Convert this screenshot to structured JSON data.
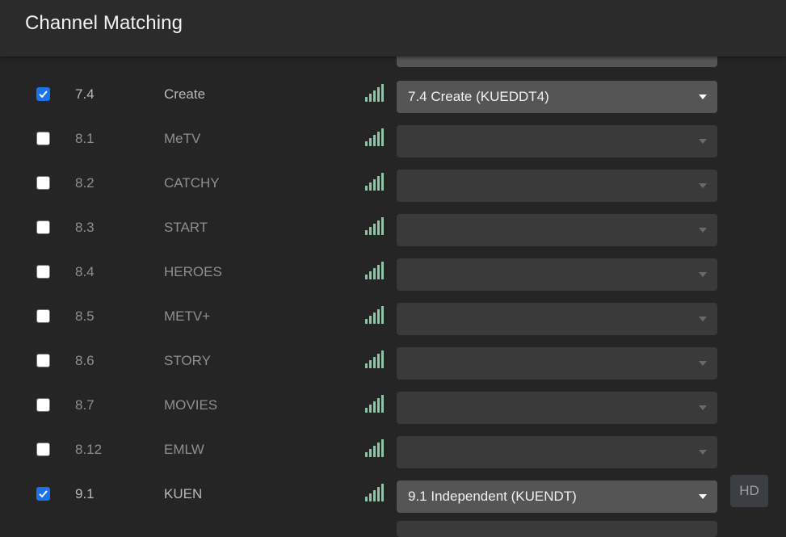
{
  "header": {
    "title": "Channel Matching"
  },
  "rows": [
    {
      "checked": true,
      "number": "7.4",
      "name": "Create",
      "match": "7.4 Create (KUEDDT4)"
    },
    {
      "checked": false,
      "number": "8.1",
      "name": "MeTV",
      "match": ""
    },
    {
      "checked": false,
      "number": "8.2",
      "name": "CATCHY",
      "match": ""
    },
    {
      "checked": false,
      "number": "8.3",
      "name": "START",
      "match": ""
    },
    {
      "checked": false,
      "number": "8.4",
      "name": "HEROES",
      "match": ""
    },
    {
      "checked": false,
      "number": "8.5",
      "name": "METV+",
      "match": ""
    },
    {
      "checked": false,
      "number": "8.6",
      "name": "STORY",
      "match": ""
    },
    {
      "checked": false,
      "number": "8.7",
      "name": "MOVIES",
      "match": ""
    },
    {
      "checked": false,
      "number": "8.12",
      "name": "EMLW",
      "match": ""
    },
    {
      "checked": true,
      "number": "9.1",
      "name": "KUEN",
      "match": "9.1 Independent (KUENDT)",
      "badge": "HD"
    }
  ],
  "icons": {
    "signal": "signal-strength-icon",
    "dropdown": "chevron-down-icon",
    "check": "checkmark-icon"
  },
  "colors": {
    "signal": "#8fc4a4",
    "checkbox_checked": "#1a73e8",
    "background": "#252525"
  }
}
